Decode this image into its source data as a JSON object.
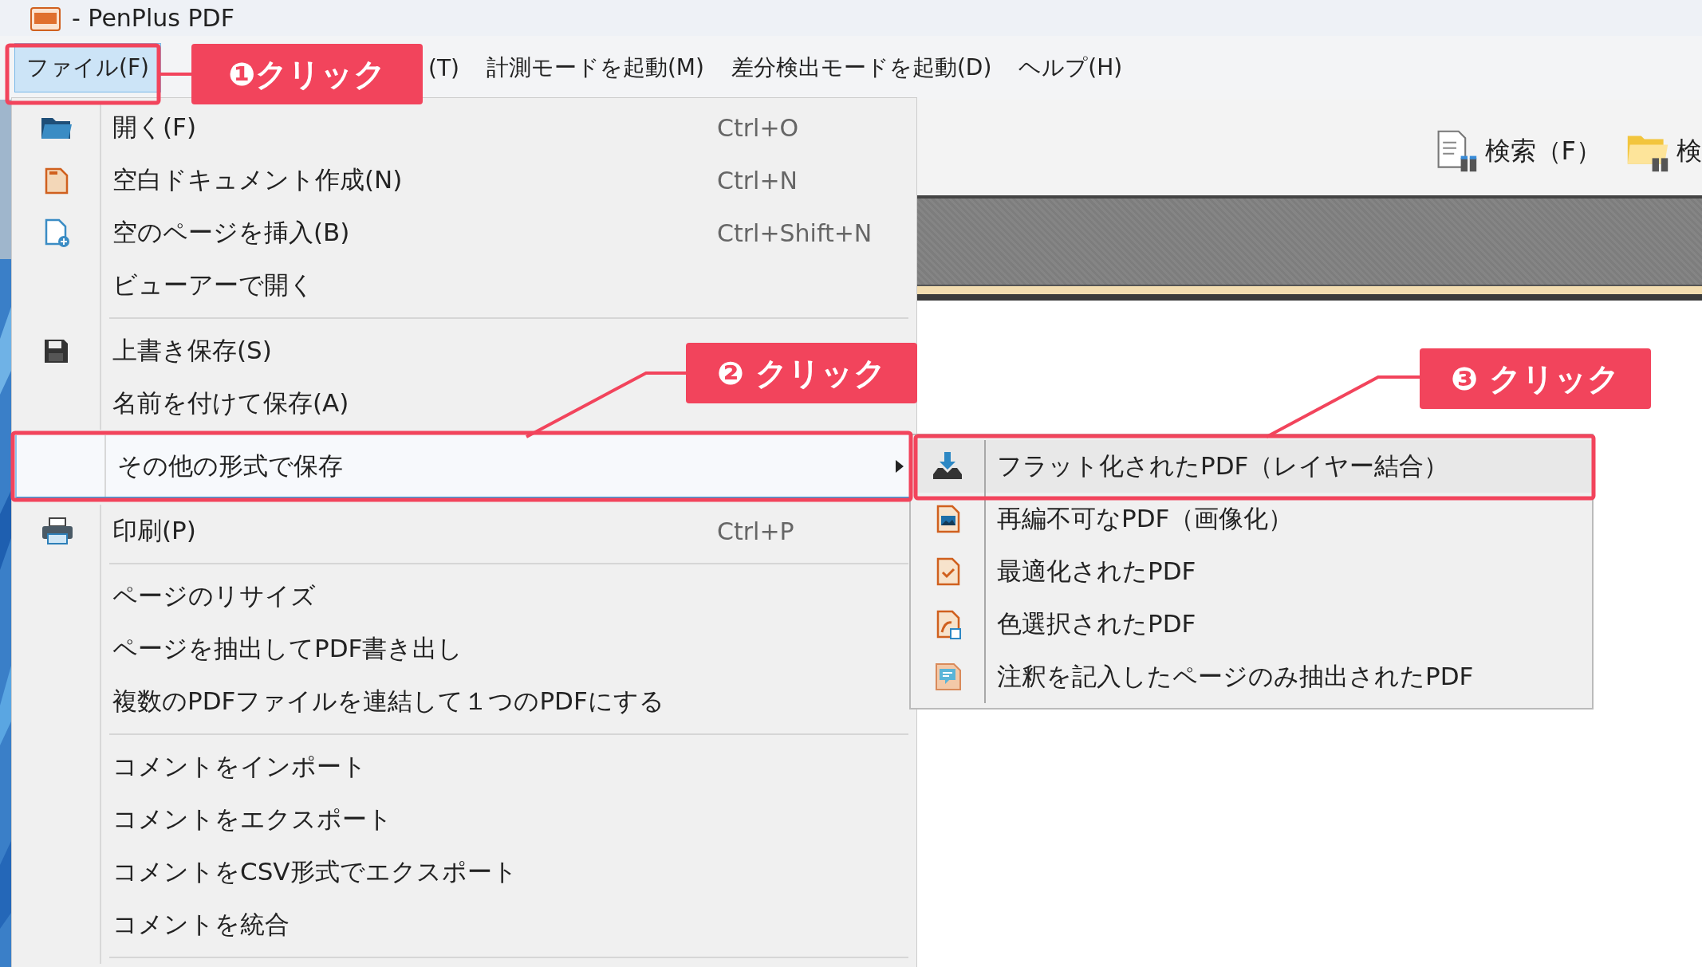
{
  "window": {
    "title": "- PenPlus PDF"
  },
  "menubar": [
    {
      "label": "ファイル(F)",
      "selected": true
    },
    {
      "label": "(T)",
      "selected": false
    },
    {
      "label": "計測モードを起動(M)",
      "selected": false
    },
    {
      "label": "差分検出モードを起動(D)",
      "selected": false
    },
    {
      "label": "ヘルプ(H)",
      "selected": false
    }
  ],
  "toolbar": [
    {
      "label": "検索（F）"
    },
    {
      "label": "検"
    }
  ],
  "file_menu": {
    "items": [
      {
        "kind": "item",
        "label": "開く(F)",
        "shortcut": "Ctrl+O"
      },
      {
        "kind": "item",
        "label": "空白ドキュメント作成(N)",
        "shortcut": "Ctrl+N"
      },
      {
        "kind": "item",
        "label": "空のページを挿入(B)",
        "shortcut": "Ctrl+Shift+N"
      },
      {
        "kind": "item",
        "label": "ビューアーで開く"
      },
      {
        "kind": "separator"
      },
      {
        "kind": "item",
        "label": "上書き保存(S)"
      },
      {
        "kind": "item",
        "label": "名前を付けて保存(A)"
      },
      {
        "kind": "submenu",
        "label": "その他の形式で保存",
        "selected": true
      },
      {
        "kind": "item",
        "label": "印刷(P)",
        "shortcut": "Ctrl+P"
      },
      {
        "kind": "separator"
      },
      {
        "kind": "item",
        "label": "ページのリサイズ"
      },
      {
        "kind": "item",
        "label": "ページを抽出してPDF書き出し"
      },
      {
        "kind": "item",
        "label": "複数のPDFファイルを連結して１つのPDFにする"
      },
      {
        "kind": "separator"
      },
      {
        "kind": "item",
        "label": "コメントをインポート"
      },
      {
        "kind": "item",
        "label": "コメントをエクスポート"
      },
      {
        "kind": "item",
        "label": "コメントをCSV形式でエクスポート"
      },
      {
        "kind": "item",
        "label": "コメントを統合"
      },
      {
        "kind": "separator"
      }
    ]
  },
  "submenu": {
    "items": [
      {
        "label": "フラット化されたPDF（レイヤー結合）",
        "selected": true
      },
      {
        "label": "再編不可なPDF（画像化）",
        "selected": false
      },
      {
        "label": "最適化されたPDF",
        "selected": false
      },
      {
        "label": "色選択されたPDF",
        "selected": false
      },
      {
        "label": "注釈を記入したページのみ抽出されたPDF",
        "selected": false
      }
    ]
  },
  "callouts": [
    {
      "label": "❶クリック"
    },
    {
      "label": "❷ クリック"
    },
    {
      "label": "❸ クリック"
    }
  ]
}
